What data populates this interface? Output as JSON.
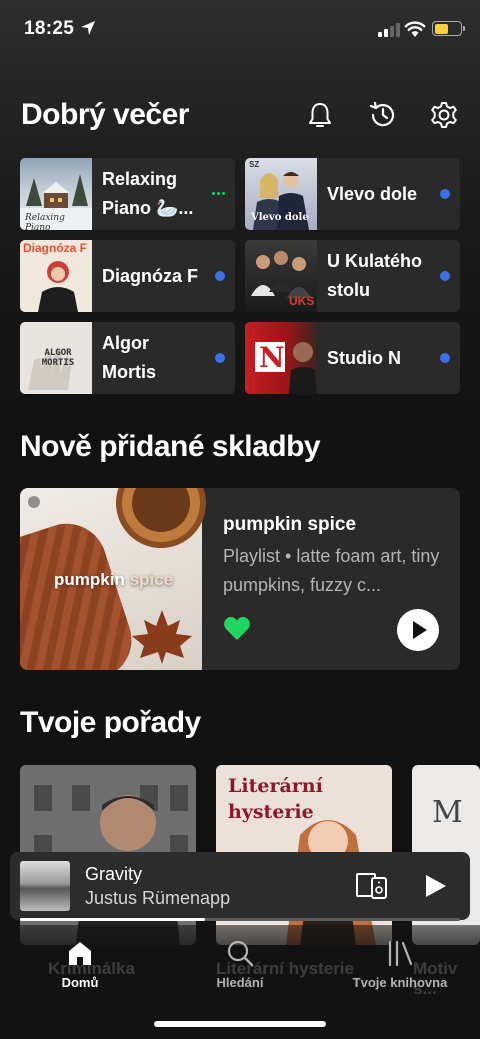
{
  "status": {
    "time": "18:25",
    "battery_level": 0.55,
    "battery_color": "#f5d142"
  },
  "header": {
    "greeting": "Dobrý večer",
    "icons": [
      "bell-icon",
      "history-icon",
      "gear-icon"
    ]
  },
  "quick": [
    {
      "title": "Relaxing Piano 🦢...",
      "indicator": "ellipsis",
      "art_label": "Relaxing Piano"
    },
    {
      "title": "Vlevo dole",
      "indicator": "new-dot",
      "art_label": "Vlevo dole"
    },
    {
      "title": "Diagnóza F",
      "indicator": "new-dot",
      "art_label": "Diagnóza F"
    },
    {
      "title": "U Kulatého stolu",
      "indicator": "new-dot",
      "art_label": "UKS"
    },
    {
      "title": "Algor Mortis",
      "indicator": "new-dot",
      "art_label": "ALGOR MORTIS"
    },
    {
      "title": "Studio N",
      "indicator": "new-dot",
      "art_label": "N"
    }
  ],
  "section_new": {
    "title": "Nově přidané skladby"
  },
  "featured": {
    "title": "pumpkin spice",
    "subtitle": "Playlist • latte foam art, tiny pumpkins, fuzzy c...",
    "art_text_a": "pumpkin",
    "art_text_b": "spice",
    "liked": true,
    "like_color": "#1ed760"
  },
  "section_shows": {
    "title": "Tvoje pořady"
  },
  "shows": [
    {
      "label": "Kriminálka"
    },
    {
      "label": "Literární hysterie",
      "art_title": "Literární hysterie"
    },
    {
      "label": "Motiv s...",
      "art_title": "M"
    }
  ],
  "now_playing": {
    "title": "Gravity",
    "artist": "Justus Rümenapp",
    "progress": 0.42
  },
  "nav": [
    {
      "label": "Domů",
      "active": true
    },
    {
      "label": "Hledání",
      "active": false
    },
    {
      "label": "Tvoje knihovna",
      "active": false
    }
  ],
  "colors": {
    "accent": "#1ed760",
    "new_dot": "#3a6fe8",
    "card": "#2a2a2a",
    "bg": "#121212"
  }
}
